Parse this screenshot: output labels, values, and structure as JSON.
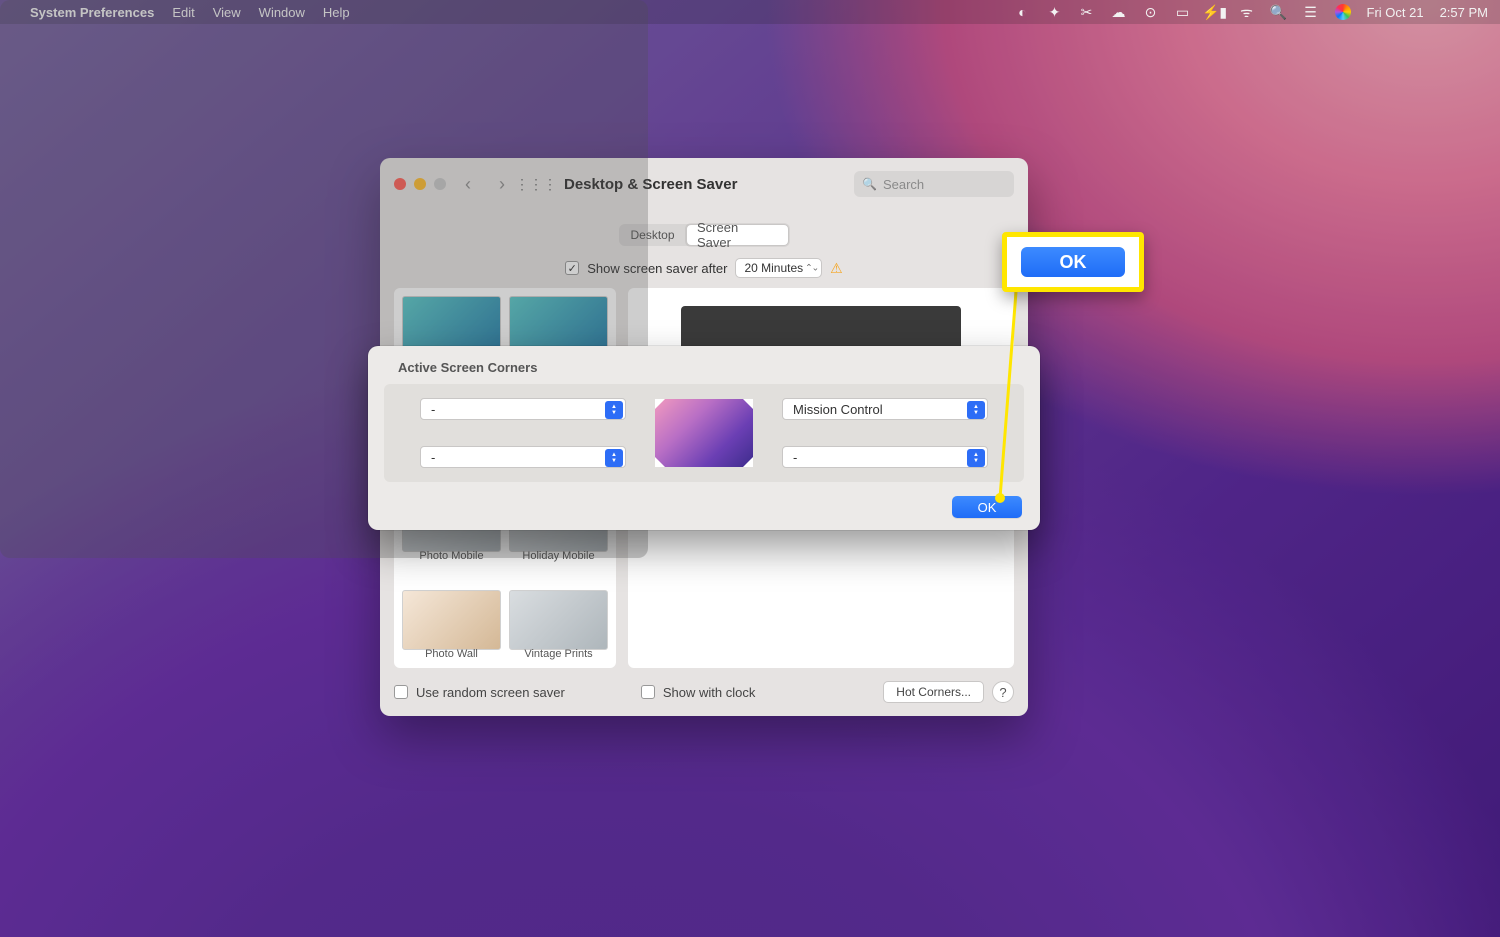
{
  "menu": {
    "app": "System Preferences",
    "items": [
      "Edit",
      "View",
      "Window",
      "Help"
    ],
    "date": "Fri Oct 21",
    "time": "2:57 PM"
  },
  "window": {
    "title": "Desktop & Screen Saver",
    "search_placeholder": "Search",
    "tabs": {
      "desk": "Desktop",
      "ss": "Screen Saver"
    },
    "show_after_label": "Show screen saver after",
    "show_after_value": "20 Minutes",
    "thumbs": [
      "Photo Mobile",
      "Holiday Mobile",
      "Photo Wall",
      "Vintage Prints"
    ],
    "use_random": "Use random screen saver",
    "show_clock": "Show with clock",
    "hot_corners_btn": "Hot Corners...",
    "help": "?"
  },
  "sheet": {
    "title": "Active Screen Corners",
    "corners": {
      "tl": "-",
      "tr": "Mission Control",
      "bl": "-",
      "br": "-"
    },
    "ok": "OK"
  },
  "callout": {
    "ok": "OK"
  }
}
